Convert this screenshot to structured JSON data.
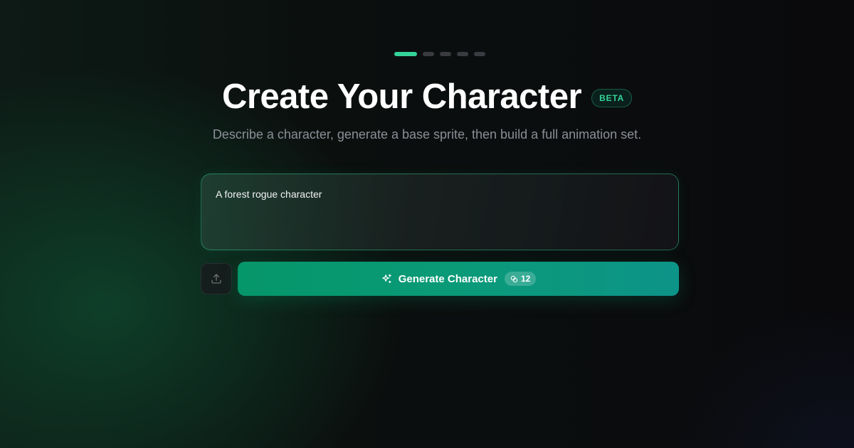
{
  "stepper": {
    "steps": [
      {
        "state": "active"
      },
      {
        "state": "inactive"
      },
      {
        "state": "inactive"
      },
      {
        "state": "inactive"
      },
      {
        "state": "inactive"
      }
    ],
    "current_step": 1,
    "total_steps": 5
  },
  "header": {
    "title": "Create Your Character",
    "badge": "BETA",
    "subtitle": "Describe a character, generate a base sprite, then build a full animation set."
  },
  "prompt": {
    "value": "A forest rogue character"
  },
  "actions": {
    "upload_icon": "upload-icon",
    "generate_label": "Generate Character",
    "generate_icon": "sparkles-icon",
    "credit_icon": "coins-icon",
    "credit_cost": "12"
  },
  "colors": {
    "accent": "#34d399",
    "button_start": "#059669",
    "button_end": "#0d9488",
    "background": "#0b0b0e"
  }
}
